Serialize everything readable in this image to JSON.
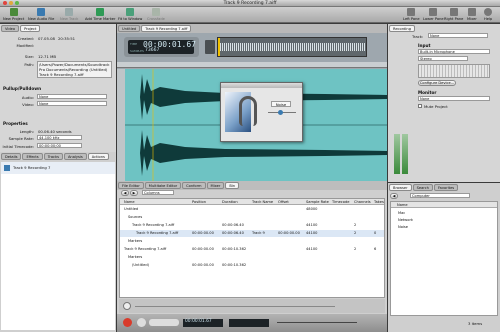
{
  "window": {
    "title": "Track 9 Recording 7.aiff"
  },
  "toolbar": {
    "left": [
      "New Project",
      "New Audio File",
      "New Track",
      "Add Time Marker",
      "Fit to Window",
      "Crossfade"
    ],
    "right": [
      "Left Pane",
      "Lower Pane",
      "Right Pane",
      "Mixer",
      "Help"
    ]
  },
  "left": {
    "tabs": [
      "Video",
      "Project"
    ],
    "created_lbl": "Created:",
    "created": "07.05.08",
    "created_time": "20:35:51",
    "modified_lbl": "Modified:",
    "size_lbl": "Size:",
    "size": "12.71 MB",
    "path_lbl": "Path:",
    "path": [
      "/Users/Power/Documents/Soundtrack",
      "Pro Documents/Recording (Untitled)",
      "Track 9 Recording 7.aiff"
    ],
    "pullup_title": "Pullup/Pulldown",
    "audio_lbl": "Audio:",
    "audio_val": "None",
    "video_lbl": "Video:",
    "video_val": "None",
    "props_title": "Properties",
    "length_lbl": "Length:",
    "length": "00.06.40 seconds",
    "rate_lbl": "Sample Rate:",
    "rate": "44.100 kHz",
    "tc_lbl": "Initial Timecode:",
    "tc": "00:00:00;00",
    "bottom_tabs": [
      "Details",
      "Effects",
      "Tracks",
      "Analysis",
      "Actions"
    ],
    "action_item": "Track 9 Recording 7"
  },
  "center": {
    "doc_tabs": [
      "Untitled",
      "Track 9 Recording 7.aiff"
    ],
    "time_lbl": "TIME",
    "time": "00:00:01.67",
    "samples_lbl": "SAMPLES",
    "samples": "73667",
    "plugin_title": "Noise",
    "lower_tabs": [
      "File Editor",
      "Multitake Editor",
      "Conform",
      "Mixer",
      "Bin"
    ],
    "view_lbl": "Columns",
    "columns": [
      "Name",
      "Position",
      "Duration",
      "Track Name",
      "Offset",
      "Sample Rate",
      "Timecode",
      "Channels",
      "Takes"
    ],
    "rows": [
      {
        "name": "Untitled",
        "pos": "",
        "dur": "",
        "track": "",
        "off": "",
        "rate": "48000",
        "tc": "",
        "ch": "",
        "tk": ""
      },
      {
        "name": "Sources",
        "pos": "",
        "dur": "",
        "track": "",
        "off": "",
        "rate": "",
        "tc": "",
        "ch": "",
        "tk": ""
      },
      {
        "name": "Track 9 Recording 7.aiff",
        "pos": "",
        "dur": "00:00:06.40",
        "track": "",
        "off": "",
        "rate": "44100",
        "tc": "",
        "ch": "2",
        "tk": ""
      },
      {
        "name": "Track 9 Recording 7.aiff",
        "pos": "00:00:00.00",
        "dur": "00:00:06.40",
        "track": "Track 9",
        "off": "00:00:00.00",
        "rate": "44100",
        "tc": "",
        "ch": "2",
        "tk": "0"
      },
      {
        "name": "Markers",
        "pos": "",
        "dur": "",
        "track": "",
        "off": "",
        "rate": "",
        "tc": "",
        "ch": "",
        "tk": ""
      },
      {
        "name": "Track 9 Recording 7.aiff",
        "pos": "00:00:00.00",
        "dur": "00:00:10.362",
        "track": "",
        "off": "",
        "rate": "44100",
        "tc": "",
        "ch": "2",
        "tk": "6"
      },
      {
        "name": "Markers",
        "pos": "",
        "dur": "",
        "track": "",
        "off": "",
        "rate": "",
        "tc": "",
        "ch": "",
        "tk": ""
      },
      {
        "name": "(Untitled)",
        "pos": "00:00:00.00",
        "dur": "00:00:10.362",
        "track": "",
        "off": "",
        "rate": "",
        "tc": "",
        "ch": "",
        "tk": ""
      }
    ],
    "transport_time": "00:00:01.67"
  },
  "right": {
    "tab": "Recording",
    "track_lbl": "Track:",
    "track_val": "None",
    "input_title": "Input",
    "input_val": "Built-in Microphone",
    "channel_val": "Stereo",
    "configure": "Configure Device...",
    "monitor_title": "Monitor",
    "monitor_val": "None",
    "mute": "Mute Project",
    "browser_tabs": [
      "Browser",
      "Search",
      "Favorites"
    ],
    "location": "Computer",
    "name_col": "Name",
    "items": [
      "Mac",
      "Network",
      "Noise"
    ],
    "count": "3 items"
  },
  "colors": {
    "wave": "#6ec3c3",
    "waveDark": "#0f3a3a",
    "accent": "#2f6fb5"
  }
}
